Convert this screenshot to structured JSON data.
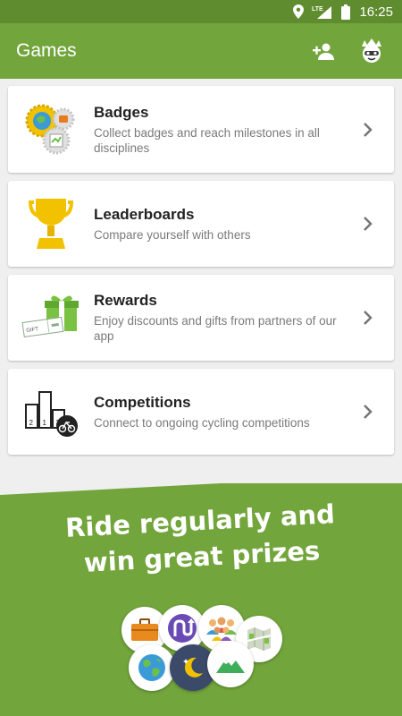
{
  "status_bar": {
    "time": "16:25",
    "network": "LTE",
    "icons": [
      "location-icon",
      "signal-icon",
      "battery-icon"
    ]
  },
  "app_bar": {
    "title": "Games",
    "actions": [
      "add-friend-icon",
      "profile-avatar-icon"
    ]
  },
  "cards": [
    {
      "title": "Badges",
      "subtitle": "Collect badges and reach milestones in all disciplines",
      "icon": "badges-icon"
    },
    {
      "title": "Leaderboards",
      "subtitle": "Compare yourself with others",
      "icon": "trophy-icon"
    },
    {
      "title": "Rewards",
      "subtitle": "Enjoy discounts and gifts from partners of our app",
      "icon": "gift-icon",
      "gift_tag": "GIFT"
    },
    {
      "title": "Competitions",
      "subtitle": "Connect to ongoing cycling competitions",
      "icon": "podium-icon",
      "podium_labels": [
        "2",
        "1",
        "3"
      ]
    }
  ],
  "promo": {
    "line1": "Ride regularly and",
    "line2": "win great prizes",
    "badges": [
      "briefcase-icon",
      "route-icon",
      "people-icon",
      "map-icon",
      "globe-icon",
      "moon-icon",
      "mountain-icon"
    ]
  },
  "colors": {
    "status_bar": "#5f8c2e",
    "app_bar": "#72a53c",
    "background": "#efefef",
    "card": "#ffffff",
    "title_text": "#222222",
    "subtitle_text": "#7a7a7a"
  }
}
